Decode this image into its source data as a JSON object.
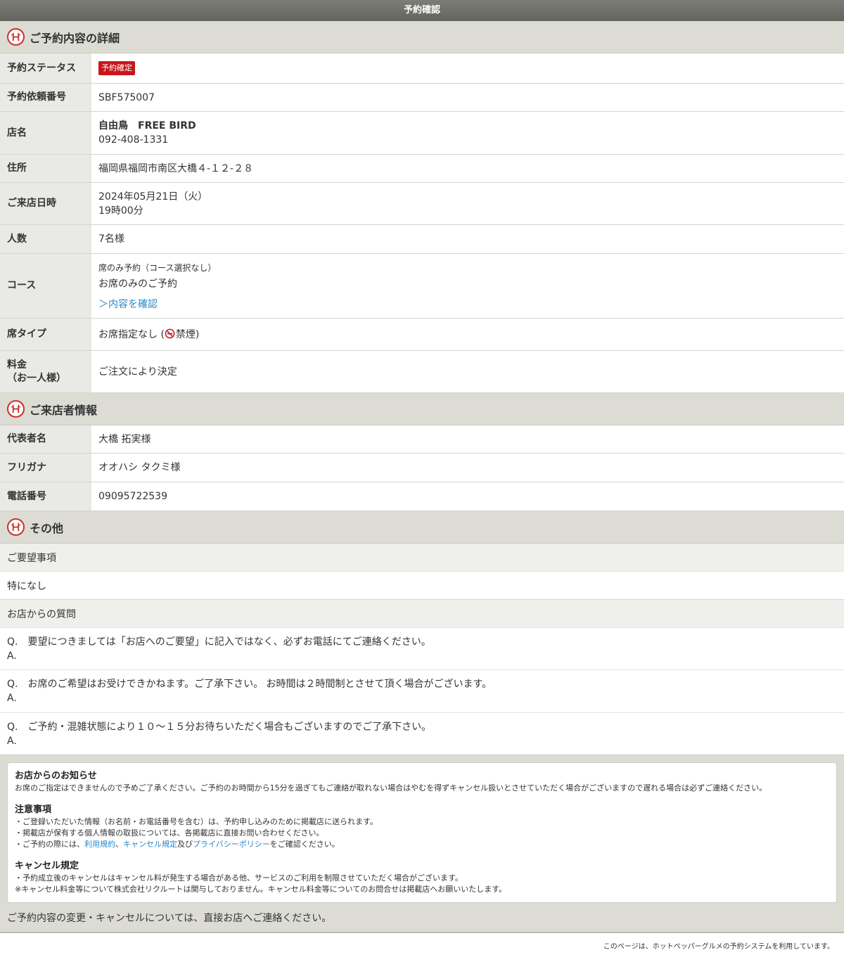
{
  "topbar": {
    "title": "予約確認"
  },
  "sections": {
    "details": "ご予約内容の詳細",
    "visitor": "ご来店者情報",
    "other": "その他"
  },
  "details": {
    "status": {
      "label": "予約ステータス",
      "badge": "予約確定"
    },
    "request_no": {
      "label": "予約依頼番号",
      "value": "SBF575007"
    },
    "shop": {
      "label": "店名",
      "name": "自由鳥　FREE BIRD",
      "tel": "092-408-1331"
    },
    "address": {
      "label": "住所",
      "value": "福岡県福岡市南区大橋４-１２-２８"
    },
    "datetime": {
      "label": "ご来店日時",
      "date": "2024年05月21日（火）",
      "time": "19時00分"
    },
    "people": {
      "label": "人数",
      "value": "7名様"
    },
    "course": {
      "label": "コース",
      "type": "席のみ予約（コース選択なし）",
      "name": "お席のみのご予約",
      "link": "＞内容を確認"
    },
    "seat": {
      "label": "席タイプ",
      "prefix": "お席指定なし (",
      "smoking": "禁煙",
      "suffix": ")"
    },
    "price": {
      "label_line1": "料金",
      "label_line2": "（お一人様）",
      "value": "ご注文により決定"
    }
  },
  "visitor": {
    "rep": {
      "label": "代表者名",
      "value": "大橋 拓実様"
    },
    "kana": {
      "label": "フリガナ",
      "value": "オオハシ タクミ様"
    },
    "phone": {
      "label": "電話番号",
      "value": "09095722539"
    }
  },
  "other": {
    "requests_label": "ご要望事項",
    "requests_value": "特になし",
    "questions_label": "お店からの質問",
    "qa": [
      {
        "q": "Q.　要望につきましては「お店へのご要望」に記入ではなく、必ずお電話にてご連絡ください。",
        "a": "A."
      },
      {
        "q": "Q.　お席のご希望はお受けできかねます。ご了承下さい。 お時間は２時間制とさせて頂く場合がございます。",
        "a": "A."
      },
      {
        "q": "Q.　ご予約・混雑状態により１０～１５分お待ちいただく場合もございますのでご了承下さい。",
        "a": "A."
      }
    ]
  },
  "notice": {
    "shop_title": "お店からのお知らせ",
    "shop_text": "お席のご指定はできませんので予めご了承ください。ご予約のお時間から15分を過ぎてもご連絡が取れない場合はやむを得ずキャンセル扱いとさせていただく場合がございますので遅れる場合は必ずご連絡ください。",
    "caution_title": "注意事項",
    "caution_1": "・ご登録いただいた情報（お名前・お電話番号を含む）は、予約申し込みのために掲載店に送られます。",
    "caution_2": "・掲載店が保有する個人情報の取扱については、各掲載店に直接お問い合わせください。",
    "caution_3_pre": "・ご予約の際には、",
    "terms_link": "利用規約",
    "sep": "、",
    "cancel_link": "キャンセル規定",
    "and": "及び",
    "privacy_link": "プライバシーポリシー",
    "caution_3_post": "をご確認ください。",
    "cancel_title": "キャンセル規定",
    "cancel_1": "・予約成立後のキャンセルはキャンセル料が発生する場合がある他、サービスのご利用を制限させていただく場合がございます。",
    "cancel_2": "※キャンセル料金等について株式会社リクルートは関与しておりません。キャンセル料金等についてのお問合せは掲載店へお願いいたします。"
  },
  "footer": {
    "contact": "ご予約内容の変更・キャンセルについては、直接お店へご連絡ください。",
    "credit": "このページは、ホットペッパーグルメの予約システムを利用しています。"
  },
  "colors": {
    "accent_red": "#c8161d",
    "link_blue": "#2a87c7",
    "header_gray": "#dcdcd5"
  }
}
